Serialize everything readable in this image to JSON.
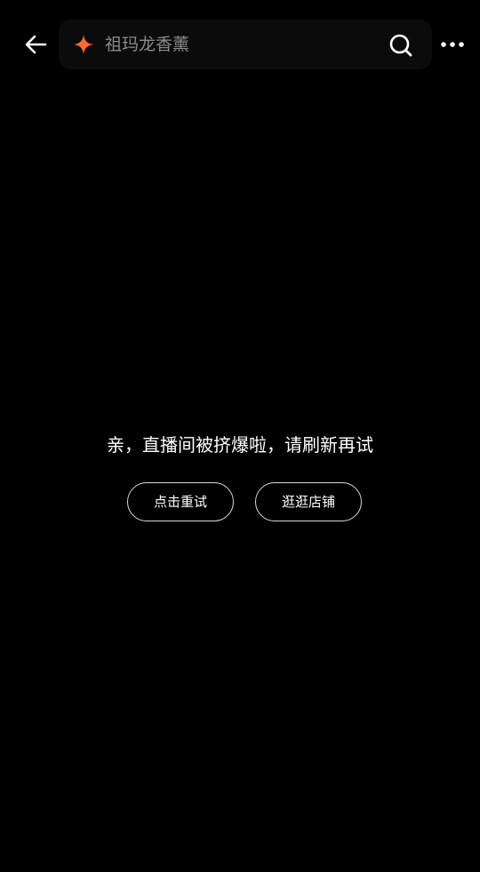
{
  "header": {
    "search_text": "祖玛龙香薰",
    "accent_color": "#ff6a2a",
    "icons": {
      "back": "back-arrow-icon",
      "spark": "spark-icon",
      "search": "search-icon",
      "more": "more-dots-icon"
    }
  },
  "main": {
    "message": "亲，直播间被挤爆啦，请刷新再试",
    "retry_label": "点击重试",
    "shop_label": "逛逛店铺"
  }
}
